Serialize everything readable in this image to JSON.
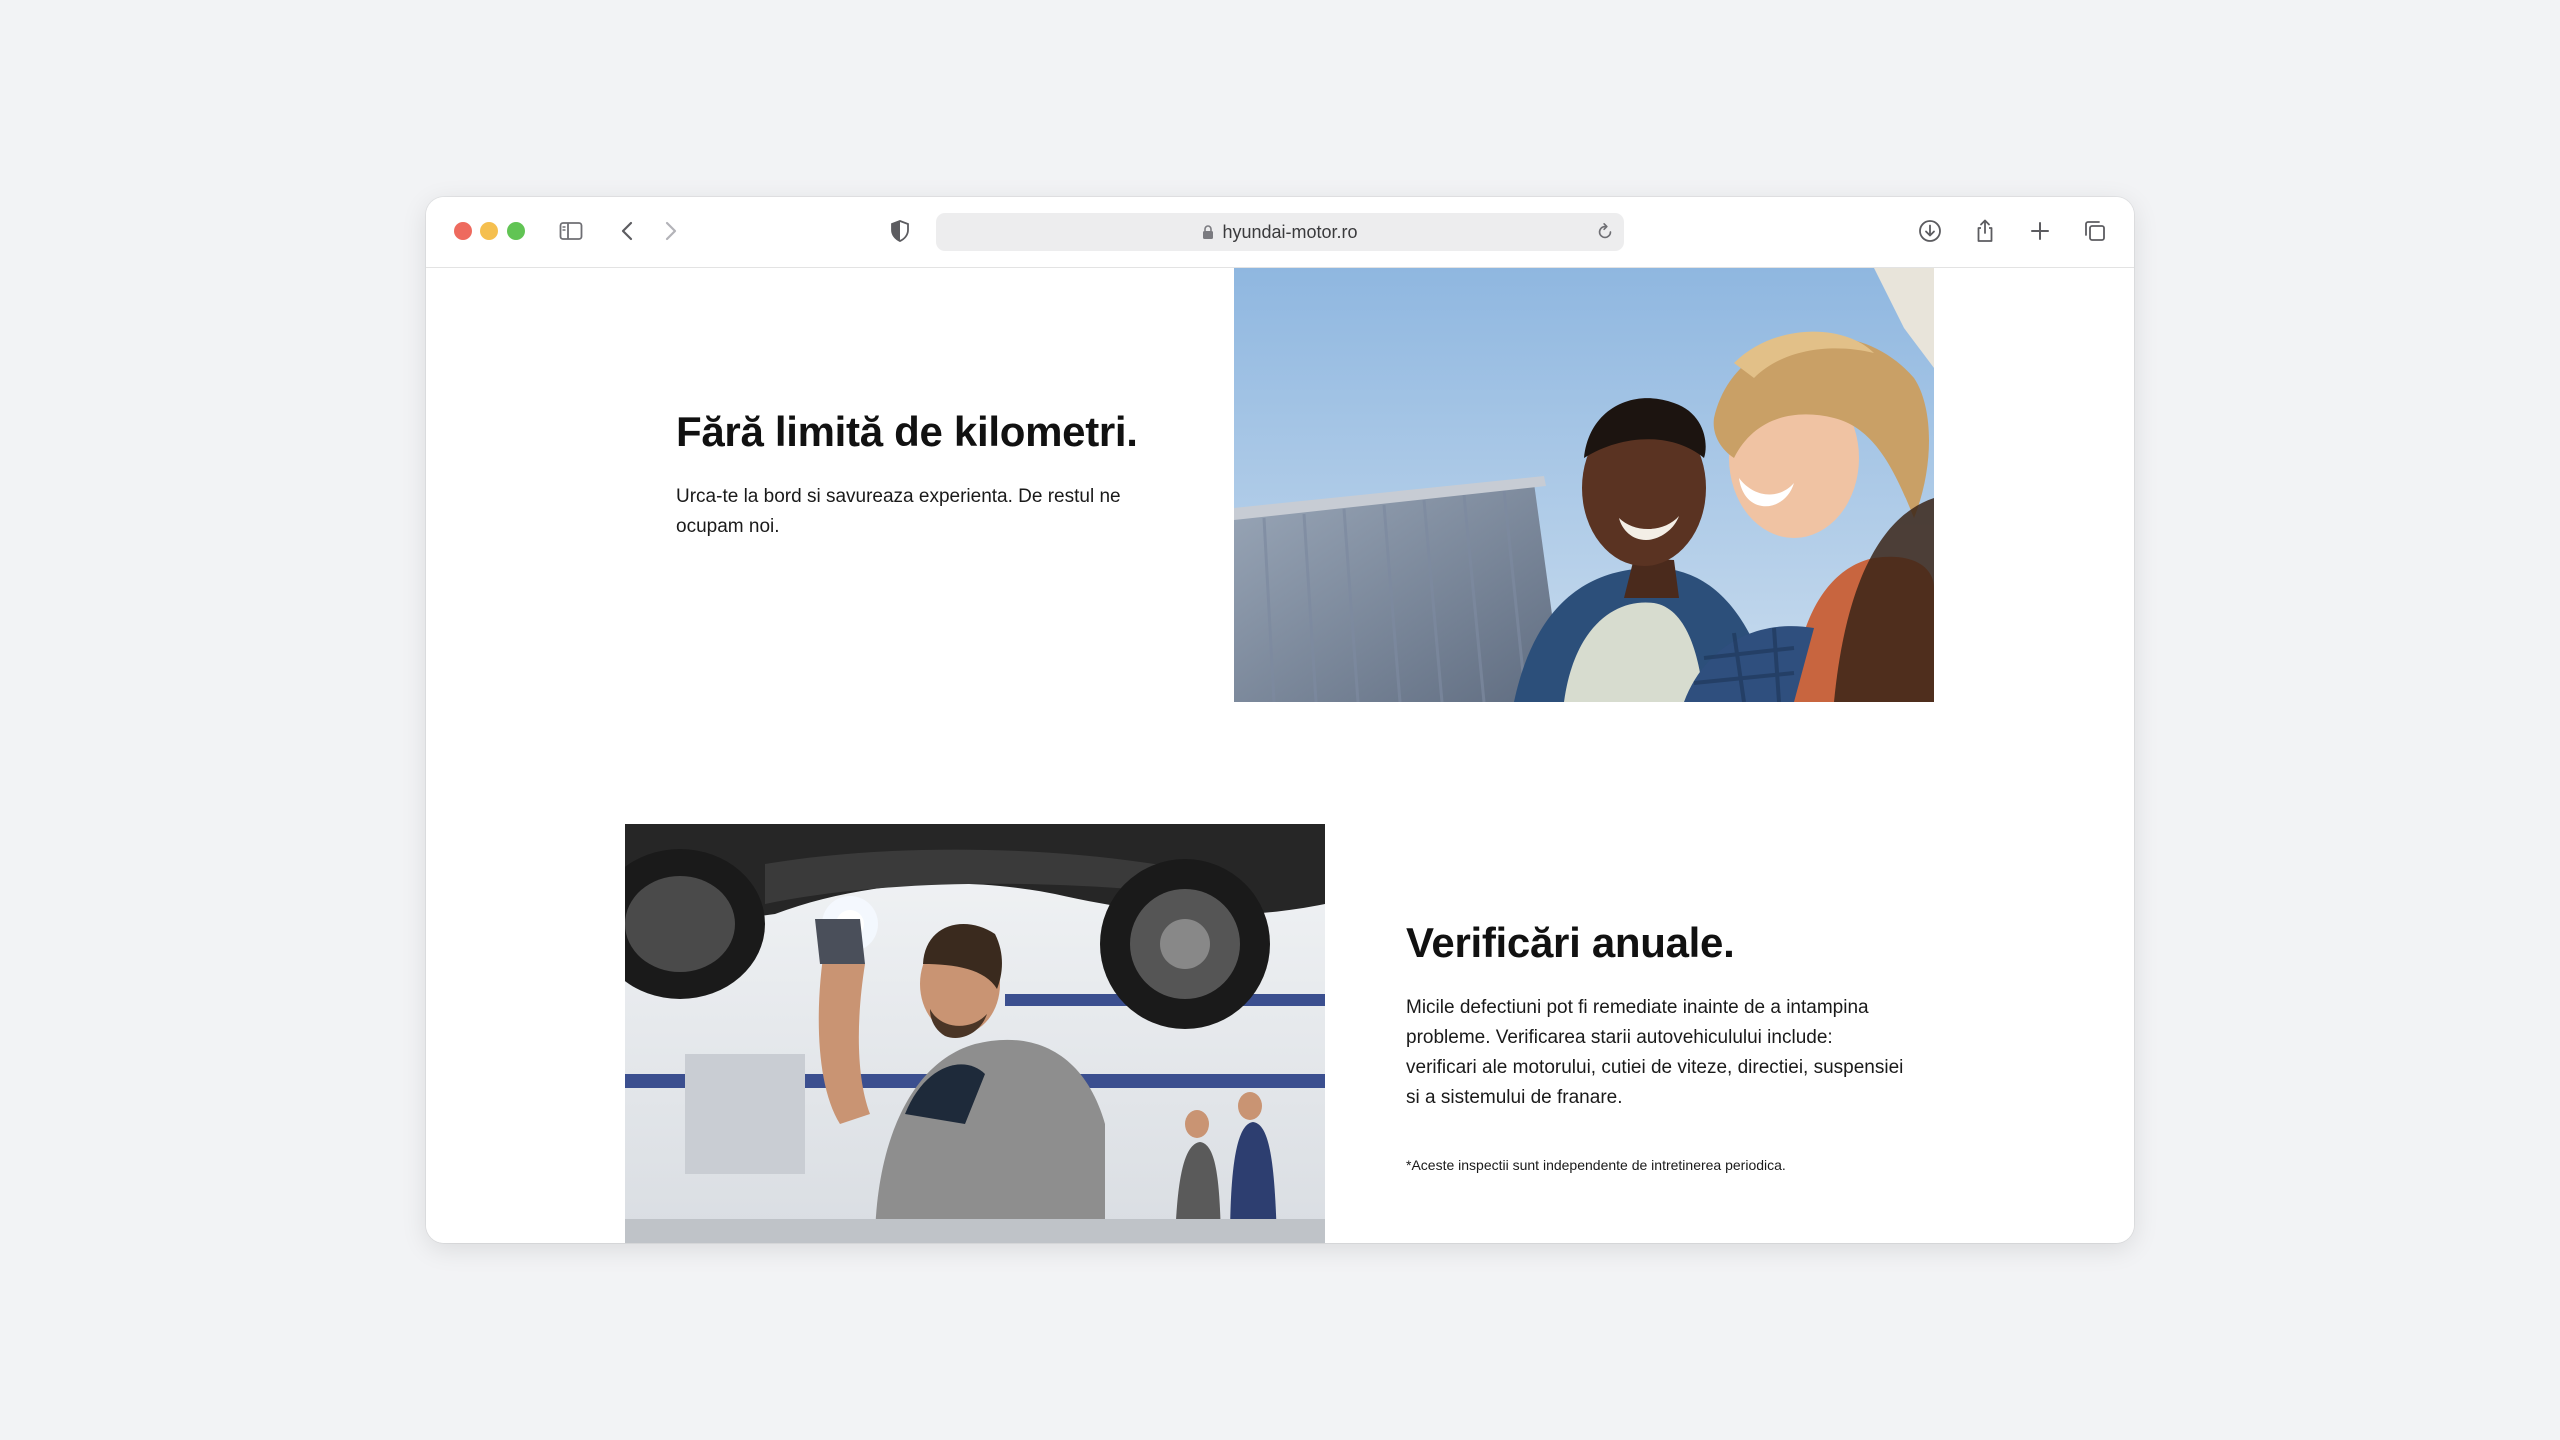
{
  "browser": {
    "url": "hyundai-motor.ro",
    "icons": {
      "sidebar": "sidebar-icon",
      "back": "chevron-left-icon",
      "forward": "chevron-right-icon",
      "privacy": "shield-icon",
      "lock": "lock-icon",
      "reload": "reload-icon",
      "download": "download-icon",
      "share": "share-icon",
      "new_tab": "plus-icon",
      "tabs": "tabs-overview-icon"
    },
    "traffic_light_colors": [
      "#ee6a5e",
      "#f5bf4f",
      "#61c454"
    ]
  },
  "sections": [
    {
      "title": "Fără limită de kilometri.",
      "body": "Urca-te la bord si savureaza experienta. De restul ne ocupam noi."
    },
    {
      "title": "Verificări anuale.",
      "body": "Micile defectiuni pot fi remediate inainte de a intampina probleme. Verificarea starii autovehiculului include: verificari ale motorului, cutiei de viteze, directiei, suspensiei si a sistemului de franare.",
      "note": "*Aceste inspectii sunt independente de intretinerea periodica."
    }
  ]
}
